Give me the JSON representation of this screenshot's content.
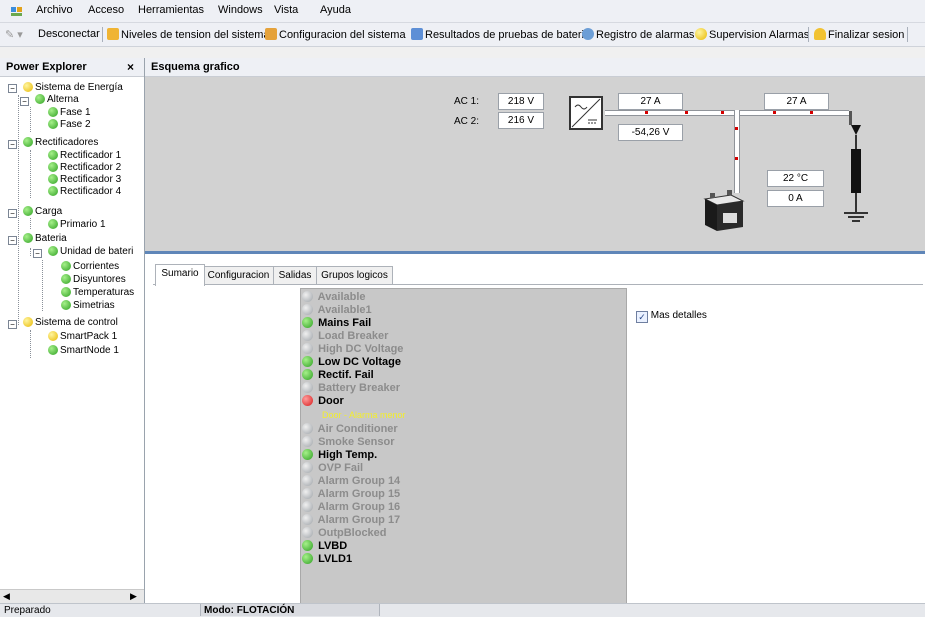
{
  "menu": [
    "Archivo",
    "Acceso",
    "Herramientas",
    "Windows",
    "Vista",
    "Ayuda"
  ],
  "toolbar": {
    "disconnect": "Desconectar",
    "voltage_levels": "Niveles de tension del sistema",
    "system_config": "Configuracion del sistema",
    "battery_tests": "Resultados de pruebas de bateria",
    "alarm_log": "Registro de alarmas",
    "alarm_supervision": "Supervision Alarmas",
    "logout": "Finalizar sesion"
  },
  "left_panel": {
    "title": "Power Explorer",
    "close": "×",
    "tree": [
      {
        "label": "Sistema de Energía",
        "color": "yellow"
      },
      {
        "label": "Alterna",
        "color": "green"
      },
      {
        "label": "Fase 1",
        "color": "green"
      },
      {
        "label": "Fase 2",
        "color": "green"
      },
      {
        "label": "Rectificadores",
        "color": "green"
      },
      {
        "label": "Rectificador 1",
        "color": "green"
      },
      {
        "label": "Rectificador 2",
        "color": "green"
      },
      {
        "label": "Rectificador 3",
        "color": "green"
      },
      {
        "label": "Rectificador 4",
        "color": "green"
      },
      {
        "label": "Carga",
        "color": "green"
      },
      {
        "label": "Primario 1",
        "color": "green"
      },
      {
        "label": "Bateria",
        "color": "green"
      },
      {
        "label": "Unidad de bateri",
        "color": "green"
      },
      {
        "label": "Corrientes",
        "color": "green"
      },
      {
        "label": "Disyuntores",
        "color": "green"
      },
      {
        "label": "Temperaturas",
        "color": "green"
      },
      {
        "label": "Simetrias",
        "color": "green"
      },
      {
        "label": "Sistema de control",
        "color": "yellow"
      },
      {
        "label": "SmartPack 1",
        "color": "yellow"
      },
      {
        "label": "SmartNode 1",
        "color": "green"
      }
    ]
  },
  "schema": {
    "title": "Esquema grafico",
    "ac1_label": "AC 1:",
    "ac1_value": "218 V",
    "ac2_label": "AC 2:",
    "ac2_value": "216 V",
    "rect_current": "27 A",
    "load_current": "27 A",
    "dc_voltage": "-54,26 V",
    "battery_temp": "22 °C",
    "battery_current": "0 A"
  },
  "tabs": [
    "Sumario",
    "Configuracion",
    "Salidas",
    "Grupos logicos"
  ],
  "alarms": [
    {
      "label": "Available",
      "state": "off"
    },
    {
      "label": "Available1",
      "state": "off"
    },
    {
      "label": "Mains Fail",
      "state": "ok"
    },
    {
      "label": "Load Breaker",
      "state": "off"
    },
    {
      "label": "High DC Voltage",
      "state": "off"
    },
    {
      "label": "Low DC Voltage",
      "state": "ok"
    },
    {
      "label": "Rectif. Fail",
      "state": "ok"
    },
    {
      "label": "Battery Breaker",
      "state": "off"
    },
    {
      "label": "Door",
      "state": "alarm"
    },
    {
      "label": "Door - Alarma menor",
      "state": "note"
    },
    {
      "label": "Air Conditioner",
      "state": "off"
    },
    {
      "label": "Smoke Sensor",
      "state": "off"
    },
    {
      "label": "High Temp.",
      "state": "ok"
    },
    {
      "label": "OVP Fail",
      "state": "off"
    },
    {
      "label": "Alarm Group 14",
      "state": "off"
    },
    {
      "label": "Alarm Group 15",
      "state": "off"
    },
    {
      "label": "Alarm Group 16",
      "state": "off"
    },
    {
      "label": "Alarm Group 17",
      "state": "off"
    },
    {
      "label": "OutpBlocked",
      "state": "off"
    },
    {
      "label": "LVBD",
      "state": "ok"
    },
    {
      "label": "LVLD1",
      "state": "ok"
    }
  ],
  "more_details": {
    "label": "Mas detalles",
    "checked": true
  },
  "status": {
    "left": "Preparado",
    "mode": "Modo: FLOTACIÓN"
  }
}
